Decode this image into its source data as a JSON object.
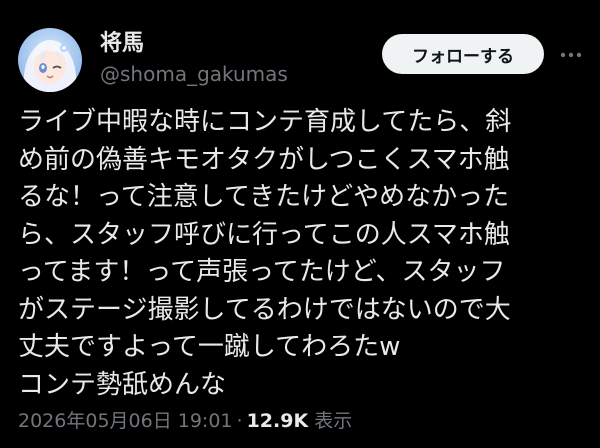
{
  "author": {
    "display_name": "将馬",
    "handle": "@shoma_gakumas",
    "avatar_icon": "anime-character-avatar-icon"
  },
  "actions": {
    "follow_label": "フォローする",
    "more_icon": "more-options-icon"
  },
  "tweet": {
    "lines": [
      "ライブ中暇な時にコンテ育成してたら、斜",
      "め前の偽善キモオタクがしつこくスマホ触",
      "るな！って注意してきたけどやめなかった",
      "ら、スタッフ呼びに行ってこの人スマホ触",
      "ってます！って声張ってたけど、スタッフ",
      "がステージ撮影してるわけではないので大",
      "丈夫ですよって一蹴してわろたw",
      "コンテ勢舐めんな"
    ],
    "timestamp": "2026年05月06日 19:01",
    "separator": "·",
    "views_count": "12.9K",
    "views_label": "表示"
  },
  "colors": {
    "background": "#000000",
    "text": "#e7e9ea",
    "muted": "#71767b",
    "button_bg": "#eff3f4",
    "button_text": "#0f1419"
  }
}
